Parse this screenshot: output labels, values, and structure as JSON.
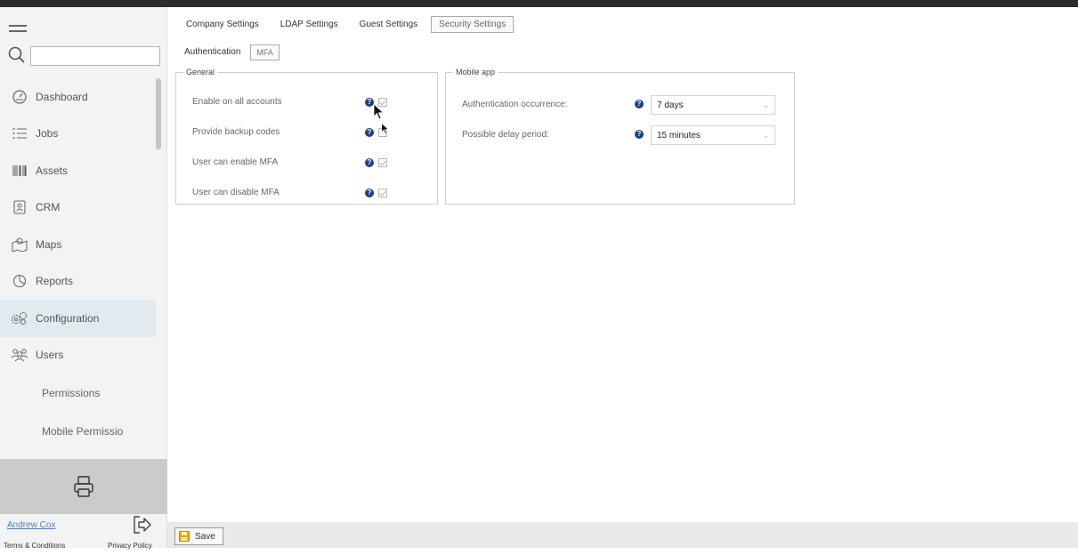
{
  "sidebar": {
    "search_placeholder": "",
    "items": [
      {
        "label": "Dashboard",
        "icon": "dashboard-icon"
      },
      {
        "label": "Jobs",
        "icon": "jobs-list-icon"
      },
      {
        "label": "Assets",
        "icon": "barcode-icon"
      },
      {
        "label": "CRM",
        "icon": "contact-card-icon"
      },
      {
        "label": "Maps",
        "icon": "map-icon"
      },
      {
        "label": "Reports",
        "icon": "reports-icon"
      },
      {
        "label": "Configuration",
        "icon": "gears-icon"
      },
      {
        "label": "Users",
        "icon": "users-icon"
      },
      {
        "label": "Permissions"
      },
      {
        "label": "Mobile Permissio"
      }
    ],
    "active_item": "Configuration",
    "user_name": "Andrew Cox",
    "terms": "Terms & Conditions",
    "privacy": "Privacy Policy"
  },
  "tabs": [
    "Company Settings",
    "LDAP Settings",
    "Guest Settings",
    "Security Settings"
  ],
  "selected_tab": "Security Settings",
  "subtabs": [
    "Authentication",
    "MFA"
  ],
  "selected_subtab": "MFA",
  "general": {
    "legend": "General",
    "rows": [
      {
        "label": "Enable on all accounts",
        "checked": true
      },
      {
        "label": "Provide backup codes",
        "checked": false
      },
      {
        "label": "User can enable MFA",
        "checked": true
      },
      {
        "label": "User can disable MFA",
        "checked": true
      }
    ]
  },
  "mobile": {
    "legend": "Mobile app",
    "rows": [
      {
        "label": "Authentication occurrence:",
        "value": "7 days"
      },
      {
        "label": "Possible delay period:",
        "value": "15 minutes"
      }
    ]
  },
  "help_glyph": "?",
  "save_label": "Save",
  "colors": {
    "help": "#1d3f8a",
    "active_nav": "#e2e9ef",
    "link": "#4a7fc1"
  }
}
